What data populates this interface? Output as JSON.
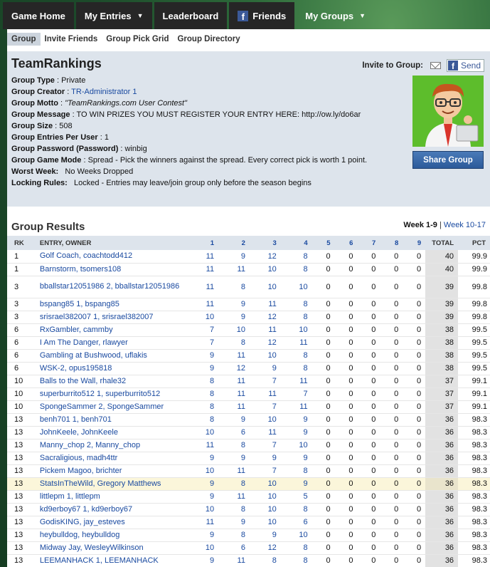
{
  "nav": {
    "items": [
      "Game Home",
      "My Entries",
      "Leaderboard",
      "Friends",
      "My Groups"
    ]
  },
  "subnav": [
    "Group",
    "Invite Friends",
    "Group Pick Grid",
    "Group Directory"
  ],
  "group": {
    "name": "TeamRankings",
    "invite_label": "Invite to Group:",
    "send_label": "Send",
    "share_label": "Share Group",
    "rows": [
      {
        "label": "Group Type",
        "sep": " : ",
        "value": "Private"
      },
      {
        "label": "Group Creator",
        "sep": " : ",
        "value": "TR-Administrator 1",
        "link": true
      },
      {
        "label": "Group Motto",
        "sep": " : ",
        "value": "\"TeamRankings.com User Contest\"",
        "italic": true
      },
      {
        "label": "Group Message",
        "sep": " : ",
        "value": "TO WIN PRIZES YOU MUST REGISTER YOUR ENTRY HERE: http://ow.ly/do6ar"
      },
      {
        "label": "Group Size",
        "sep": " : ",
        "value": "508"
      },
      {
        "label": "Group Entries Per User",
        "sep": " : ",
        "value": "1"
      },
      {
        "label": "Group Password (Password)",
        "sep": " : ",
        "value": "winbig"
      },
      {
        "label": "Group Game Mode",
        "sep": " : ",
        "value": "Spread - Pick the winners against the spread. Every correct pick is worth 1 point."
      },
      {
        "label": "Worst Week:",
        "sep": "   ",
        "value": "No Weeks Dropped"
      },
      {
        "label": "Locking Rules:",
        "sep": "   ",
        "value": "Locked - Entries may leave/join group only before the season begins"
      }
    ]
  },
  "results": {
    "title": "Group Results",
    "week_current": "Week 1-9",
    "week_sep": "|",
    "week_other": "Week 10-17",
    "headers": [
      "RK",
      "ENTRY, OWNER",
      "1",
      "2",
      "3",
      "4",
      "5",
      "6",
      "7",
      "8",
      "9",
      "TOTAL",
      "PCT"
    ],
    "rows": [
      {
        "rk": "1",
        "name": "Golf Coach, coachtodd412",
        "w": [
          "11",
          "9",
          "12",
          "8",
          "0",
          "0",
          "0",
          "0",
          "0"
        ],
        "total": "40",
        "pct": "99.9"
      },
      {
        "rk": "1",
        "name": "Barnstorm, tsomers108",
        "w": [
          "11",
          "11",
          "10",
          "8",
          "0",
          "0",
          "0",
          "0",
          "0"
        ],
        "total": "40",
        "pct": "99.9"
      },
      {
        "rk": "3",
        "name": "bballstar12051986 2, bballstar12051986",
        "w": [
          "11",
          "8",
          "10",
          "10",
          "0",
          "0",
          "0",
          "0",
          "0"
        ],
        "total": "39",
        "pct": "99.8",
        "tall": true
      },
      {
        "rk": "3",
        "name": "bspang85 1, bspang85",
        "w": [
          "11",
          "9",
          "11",
          "8",
          "0",
          "0",
          "0",
          "0",
          "0"
        ],
        "total": "39",
        "pct": "99.8"
      },
      {
        "rk": "3",
        "name": "srisrael382007 1, srisrael382007",
        "w": [
          "10",
          "9",
          "12",
          "8",
          "0",
          "0",
          "0",
          "0",
          "0"
        ],
        "total": "39",
        "pct": "99.8"
      },
      {
        "rk": "6",
        "name": "RxGambler, cammby",
        "w": [
          "7",
          "10",
          "11",
          "10",
          "0",
          "0",
          "0",
          "0",
          "0"
        ],
        "total": "38",
        "pct": "99.5"
      },
      {
        "rk": "6",
        "name": "I Am The Danger, rlawyer",
        "w": [
          "7",
          "8",
          "12",
          "11",
          "0",
          "0",
          "0",
          "0",
          "0"
        ],
        "total": "38",
        "pct": "99.5"
      },
      {
        "rk": "6",
        "name": "Gambling at Bushwood, uflakis",
        "w": [
          "9",
          "11",
          "10",
          "8",
          "0",
          "0",
          "0",
          "0",
          "0"
        ],
        "total": "38",
        "pct": "99.5"
      },
      {
        "rk": "6",
        "name": "WSK-2, opus195818",
        "w": [
          "9",
          "12",
          "9",
          "8",
          "0",
          "0",
          "0",
          "0",
          "0"
        ],
        "total": "38",
        "pct": "99.5"
      },
      {
        "rk": "10",
        "name": "Balls to the Wall, rhale32",
        "w": [
          "8",
          "11",
          "7",
          "11",
          "0",
          "0",
          "0",
          "0",
          "0"
        ],
        "total": "37",
        "pct": "99.1"
      },
      {
        "rk": "10",
        "name": "superburrito512 1, superburrito512",
        "w": [
          "8",
          "11",
          "11",
          "7",
          "0",
          "0",
          "0",
          "0",
          "0"
        ],
        "total": "37",
        "pct": "99.1"
      },
      {
        "rk": "10",
        "name": "SpongeSammer 2, SpongeSammer",
        "w": [
          "8",
          "11",
          "7",
          "11",
          "0",
          "0",
          "0",
          "0",
          "0"
        ],
        "total": "37",
        "pct": "99.1"
      },
      {
        "rk": "13",
        "name": "benh701 1, benh701",
        "w": [
          "8",
          "9",
          "10",
          "9",
          "0",
          "0",
          "0",
          "0",
          "0"
        ],
        "total": "36",
        "pct": "98.3"
      },
      {
        "rk": "13",
        "name": "JohnKeele, JohnKeele",
        "w": [
          "10",
          "6",
          "11",
          "9",
          "0",
          "0",
          "0",
          "0",
          "0"
        ],
        "total": "36",
        "pct": "98.3"
      },
      {
        "rk": "13",
        "name": "Manny_chop 2, Manny_chop",
        "w": [
          "11",
          "8",
          "7",
          "10",
          "0",
          "0",
          "0",
          "0",
          "0"
        ],
        "total": "36",
        "pct": "98.3"
      },
      {
        "rk": "13",
        "name": "Sacraligious, madh4ttr",
        "w": [
          "9",
          "9",
          "9",
          "9",
          "0",
          "0",
          "0",
          "0",
          "0"
        ],
        "total": "36",
        "pct": "98.3"
      },
      {
        "rk": "13",
        "name": "Pickem Magoo, brichter",
        "w": [
          "10",
          "11",
          "7",
          "8",
          "0",
          "0",
          "0",
          "0",
          "0"
        ],
        "total": "36",
        "pct": "98.3"
      },
      {
        "rk": "13",
        "name": "StatsInTheWild, Gregory Matthews",
        "w": [
          "9",
          "8",
          "10",
          "9",
          "0",
          "0",
          "0",
          "0",
          "0"
        ],
        "total": "36",
        "pct": "98.3",
        "highlight": true
      },
      {
        "rk": "13",
        "name": "littlepm 1, littlepm",
        "w": [
          "9",
          "11",
          "10",
          "5",
          "0",
          "0",
          "0",
          "0",
          "0"
        ],
        "total": "36",
        "pct": "98.3"
      },
      {
        "rk": "13",
        "name": "kd9erboy67 1, kd9erboy67",
        "w": [
          "10",
          "8",
          "10",
          "8",
          "0",
          "0",
          "0",
          "0",
          "0"
        ],
        "total": "36",
        "pct": "98.3"
      },
      {
        "rk": "13",
        "name": "GodisKING, jay_esteves",
        "w": [
          "11",
          "9",
          "10",
          "6",
          "0",
          "0",
          "0",
          "0",
          "0"
        ],
        "total": "36",
        "pct": "98.3"
      },
      {
        "rk": "13",
        "name": "heybulldog, heybulldog",
        "w": [
          "9",
          "8",
          "9",
          "10",
          "0",
          "0",
          "0",
          "0",
          "0"
        ],
        "total": "36",
        "pct": "98.3"
      },
      {
        "rk": "13",
        "name": "Midway Jay, WesleyWilkinson",
        "w": [
          "10",
          "6",
          "12",
          "8",
          "0",
          "0",
          "0",
          "0",
          "0"
        ],
        "total": "36",
        "pct": "98.3"
      },
      {
        "rk": "13",
        "name": "LEEMANHACK 1, LEEMANHACK",
        "w": [
          "9",
          "11",
          "8",
          "8",
          "0",
          "0",
          "0",
          "0",
          "0"
        ],
        "total": "36",
        "pct": "98.3"
      }
    ]
  }
}
